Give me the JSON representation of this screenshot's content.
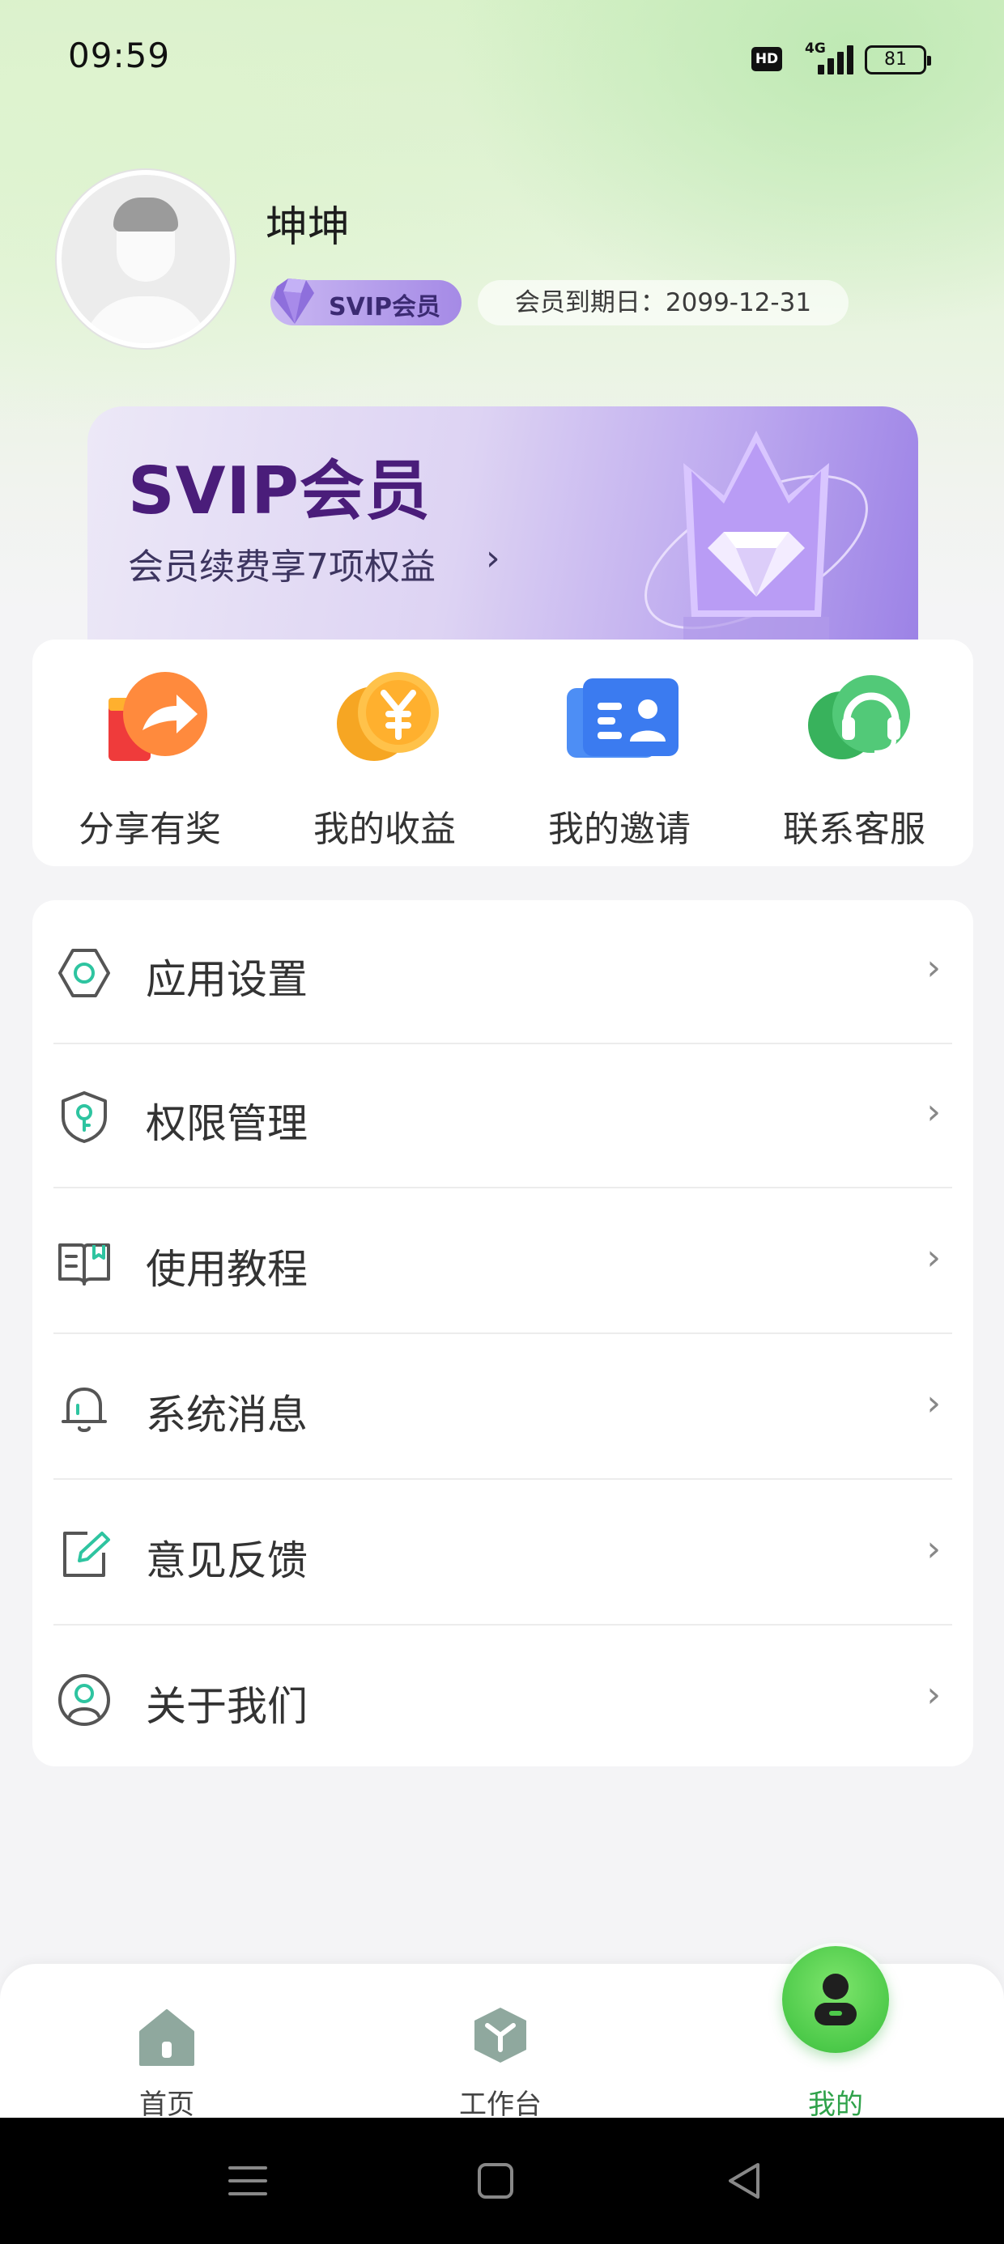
{
  "status_bar": {
    "time": "09:59",
    "hd": "HD",
    "network": "4G",
    "battery": "81"
  },
  "profile": {
    "username": "坤坤",
    "badge": "SVIP会员",
    "expire": "会员到期日：2099-12-31"
  },
  "banner": {
    "title": "SVIP会员",
    "subtitle": "会员续费享7项权益",
    "chevron": "›"
  },
  "actions": [
    {
      "label": "分享有奖",
      "icon": "gift-share-icon"
    },
    {
      "label": "我的收益",
      "icon": "coin-icon"
    },
    {
      "label": "我的邀请",
      "icon": "invite-card-icon"
    },
    {
      "label": "联系客服",
      "icon": "headset-icon"
    }
  ],
  "menu": [
    {
      "label": "应用设置",
      "icon": "settings-hexagon-icon"
    },
    {
      "label": "权限管理",
      "icon": "shield-key-icon"
    },
    {
      "label": "使用教程",
      "icon": "book-icon"
    },
    {
      "label": "系统消息",
      "icon": "bell-icon"
    },
    {
      "label": "意见反馈",
      "icon": "edit-icon"
    },
    {
      "label": "关于我们",
      "icon": "user-circle-icon"
    }
  ],
  "menu_chevron": "›",
  "tabbar": {
    "home": "首页",
    "workbench": "工作台",
    "mine": "我的"
  },
  "colors": {
    "accent_green": "#4dca4a",
    "svip_purple": "#4a1d7a",
    "icon_teal": "#2ec4a0"
  }
}
